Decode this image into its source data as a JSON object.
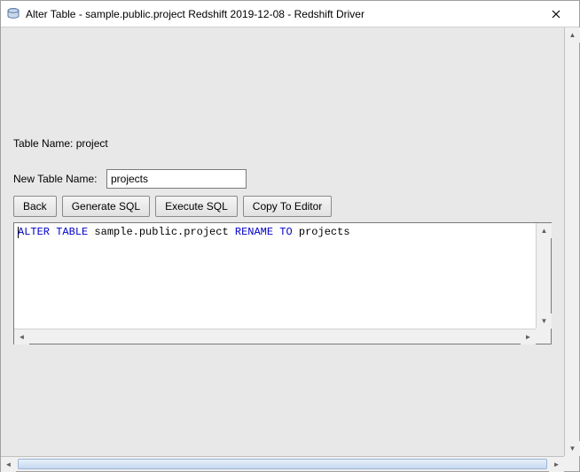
{
  "window": {
    "title": "Alter Table - sample.public.project Redshift 2019-12-08 - Redshift Driver"
  },
  "form": {
    "table_name_label": "Table Name: project",
    "new_table_name_label": "New Table Name:",
    "new_table_name_value": "projects"
  },
  "buttons": {
    "back": "Back",
    "generate_sql": "Generate SQL",
    "execute_sql": "Execute SQL",
    "copy_to_editor": "Copy To Editor"
  },
  "sql": {
    "kw1": "ALTER",
    "kw2": "TABLE",
    "mid": " sample.public.project ",
    "kw3": "RENAME",
    "kw4": "TO",
    "tail": " projects"
  }
}
